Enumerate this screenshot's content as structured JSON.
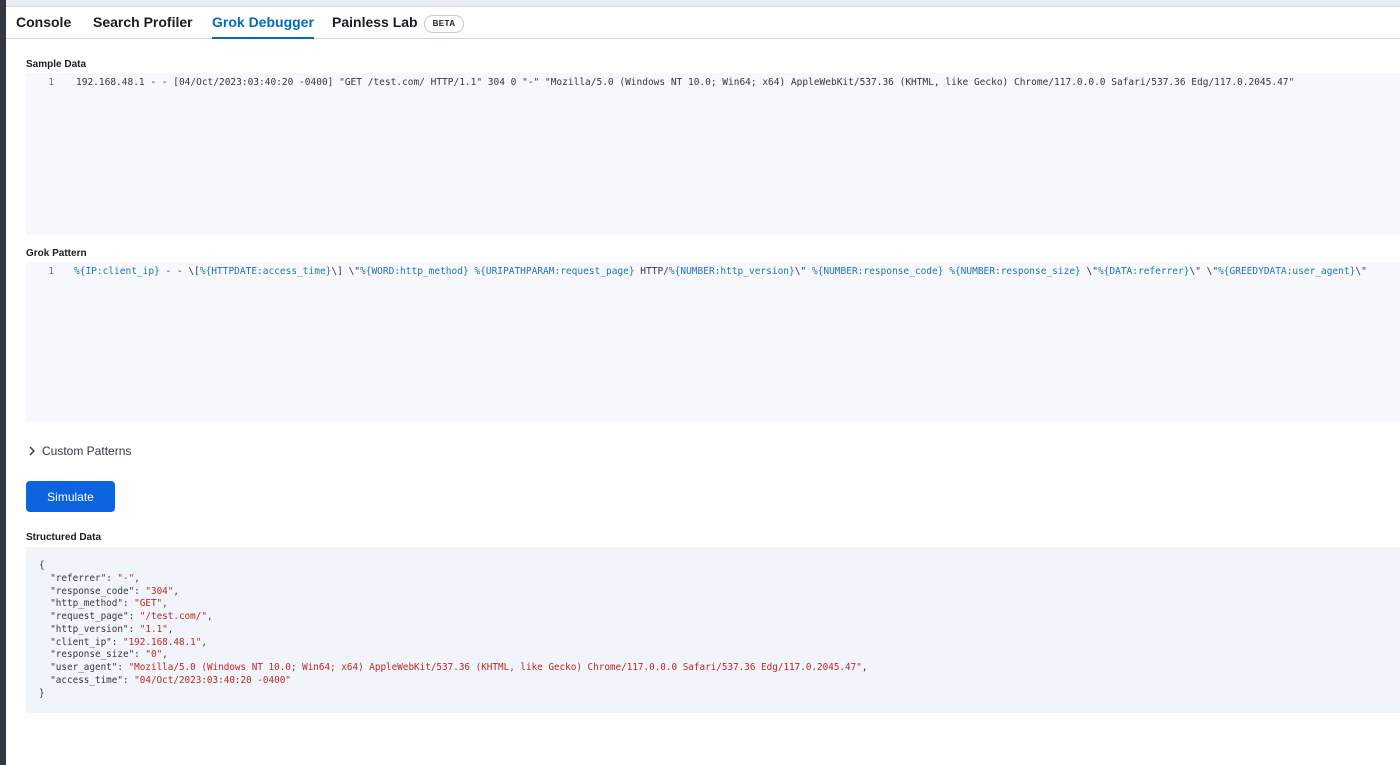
{
  "tabs": [
    {
      "label": "Console"
    },
    {
      "label": "Search Profiler"
    },
    {
      "label": "Grok Debugger"
    },
    {
      "label": "Painless Lab",
      "badge": "BETA"
    }
  ],
  "selected_tab": "Grok Debugger",
  "sample_data": {
    "label": "Sample Data",
    "line_number": "1",
    "text": "192.168.48.1 - - [04/Oct/2023:03:40:20 -0400] \"GET /test.com/ HTTP/1.1\" 304 0 \"-\" \"Mozilla/5.0 (Windows NT 10.0; Win64; x64) AppleWebKit/537.36 (KHTML, like Gecko) Chrome/117.0.0.0 Safari/537.36 Edg/117.0.2045.47\""
  },
  "grok_pattern": {
    "label": "Grok Pattern",
    "line_number": "1",
    "tokens": [
      {
        "t": "%{IP:client_ip}",
        "k": "grok"
      },
      {
        "t": " - - \\[",
        "k": "plain"
      },
      {
        "t": "%{HTTPDATE:access_time}",
        "k": "grok"
      },
      {
        "t": "\\] \\\"",
        "k": "plain"
      },
      {
        "t": "%{WORD:http_method}",
        "k": "grok"
      },
      {
        "t": " ",
        "k": "plain"
      },
      {
        "t": "%{URIPATHPARAM:request_page}",
        "k": "grok"
      },
      {
        "t": " HTTP/",
        "k": "plain"
      },
      {
        "t": "%{NUMBER:http_version}",
        "k": "grok"
      },
      {
        "t": "\\\" ",
        "k": "plain"
      },
      {
        "t": "%{NUMBER:response_code}",
        "k": "grok"
      },
      {
        "t": " ",
        "k": "plain"
      },
      {
        "t": "%{NUMBER:response_size}",
        "k": "grok"
      },
      {
        "t": " \\\"",
        "k": "plain"
      },
      {
        "t": "%{DATA:referrer}",
        "k": "grok"
      },
      {
        "t": "\\\" \\\"",
        "k": "plain"
      },
      {
        "t": "%{GREEDYDATA:user_agent}",
        "k": "grok"
      },
      {
        "t": "\\\"",
        "k": "plain"
      }
    ]
  },
  "custom_patterns": {
    "label": "Custom Patterns",
    "icon": "chevron-right-icon",
    "expanded": false
  },
  "simulate_button": {
    "label": "Simulate"
  },
  "structured_data": {
    "label": "Structured Data",
    "open_brace": "{",
    "close_brace": "}",
    "fields": [
      {
        "key": "referrer",
        "value": "-"
      },
      {
        "key": "response_code",
        "value": "304"
      },
      {
        "key": "http_method",
        "value": "GET"
      },
      {
        "key": "request_page",
        "value": "/test.com/"
      },
      {
        "key": "http_version",
        "value": "1.1"
      },
      {
        "key": "client_ip",
        "value": "192.168.48.1"
      },
      {
        "key": "response_size",
        "value": "0"
      },
      {
        "key": "user_agent",
        "value": "Mozilla/5.0 (Windows NT 10.0; Win64; x64) AppleWebKit/537.36 (KHTML, like Gecko) Chrome/117.0.0.0 Safari/537.36 Edg/117.0.2045.47"
      },
      {
        "key": "access_time",
        "value": "04/Oct/2023:03:40:20 -0400"
      }
    ]
  },
  "colors": {
    "accent": "#006bb8",
    "button": "#0b64dd",
    "grok_token": "#1f74b8",
    "json_string": "#bd271e"
  }
}
